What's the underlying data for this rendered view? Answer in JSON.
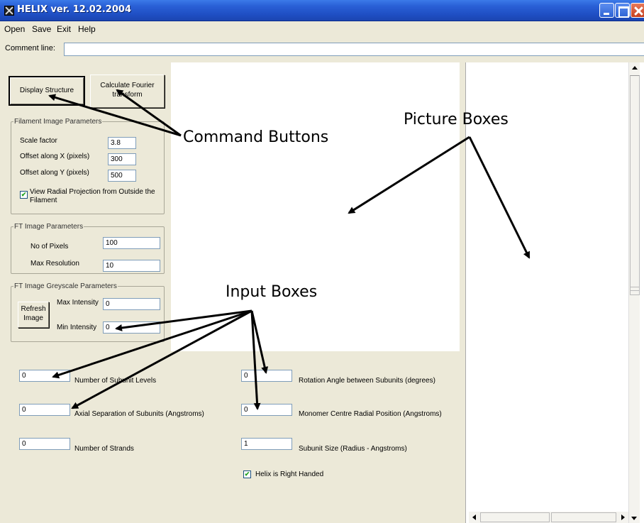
{
  "window": {
    "title": "HELIX ver. 12.02.2004"
  },
  "menu": {
    "open": "Open",
    "save": "Save",
    "exit": "Exit",
    "help": "Help"
  },
  "comment": {
    "label": "Comment line:",
    "value": ""
  },
  "buttons": {
    "display_structure": "Display Structure",
    "calculate_ft": "Calculate Fourier transform",
    "refresh_image": "Refresh Image"
  },
  "filament_params": {
    "legend": "Filament Image Parameters",
    "scale_label": "Scale factor",
    "scale_value": "3.8",
    "offset_x_label": "Offset along X (pixels)",
    "offset_x_value": "300",
    "offset_y_label": "Offset along Y (pixels)",
    "offset_y_value": "500",
    "radial_label": "View Radial Projection from Outside the Filament",
    "radial_checked": true
  },
  "ft_params": {
    "legend": "FT Image Parameters",
    "pixels_label": "No of Pixels",
    "pixels_value": "100",
    "resolution_label": "Max Resolution",
    "resolution_value": "10"
  },
  "greyscale_params": {
    "legend": "FT Image Greyscale Parameters",
    "max_label": "Max Intensity",
    "max_value": "0",
    "min_label": "Min Intensity",
    "min_value": "0"
  },
  "helix_params": {
    "subunit_levels_label": "Number of Subunit Levels",
    "subunit_levels_value": "0",
    "axial_sep_label": "Axial Separation of Subunits (Angstroms)",
    "axial_sep_value": "0",
    "strands_label": "Number of Strands",
    "strands_value": "0",
    "rotation_label": "Rotation Angle between Subunits (degrees)",
    "rotation_value": "0",
    "radial_pos_label": "Monomer Centre Radial Position (Angstroms)",
    "radial_pos_value": "0",
    "subunit_size_label": "Subunit Size (Radius - Angstroms)",
    "subunit_size_value": "1",
    "right_handed_label": "Helix is Right Handed",
    "right_handed_checked": true
  },
  "annotations": {
    "command_buttons": "Command Buttons",
    "picture_boxes": "Picture Boxes",
    "input_boxes": "Input Boxes"
  }
}
